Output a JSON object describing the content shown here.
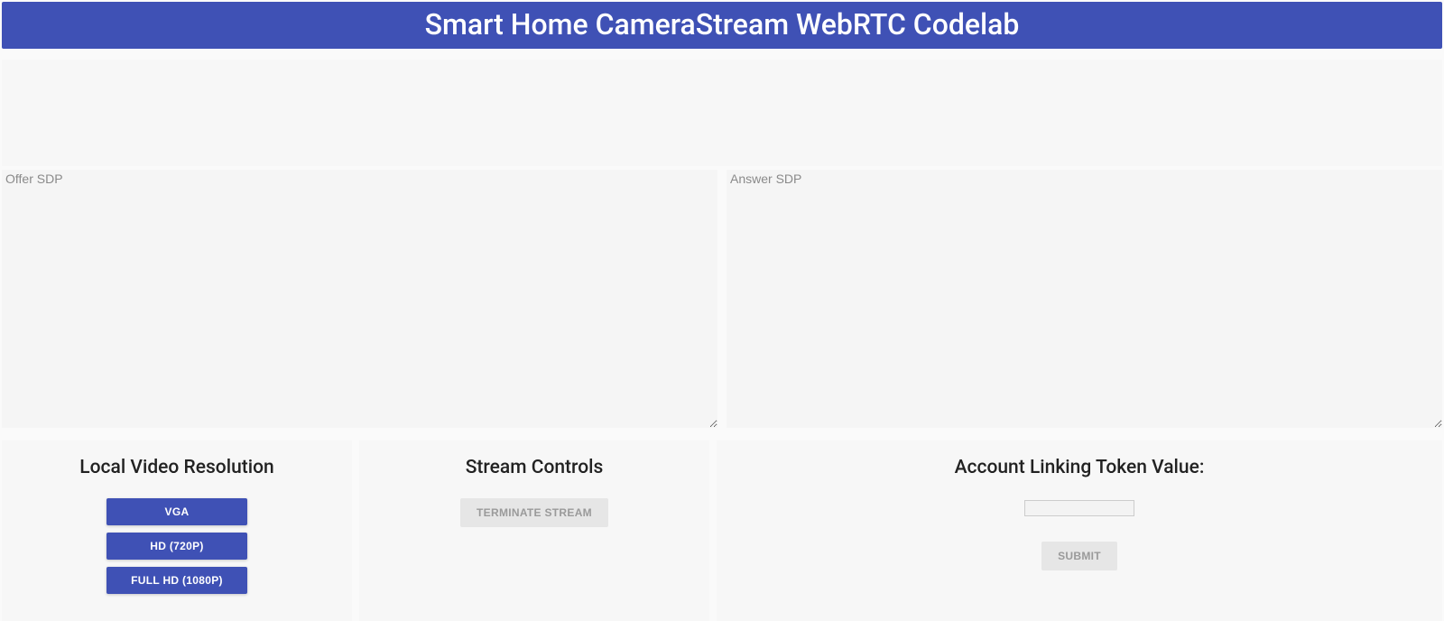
{
  "header": {
    "title": "Smart Home CameraStream WebRTC Codelab"
  },
  "sdp": {
    "offer_placeholder": "Offer SDP",
    "answer_placeholder": "Answer SDP",
    "offer_value": "",
    "answer_value": ""
  },
  "panels": {
    "resolution": {
      "title": "Local Video Resolution",
      "buttons": {
        "vga": "VGA",
        "hd": "HD (720P)",
        "fullhd": "FULL HD (1080P)"
      }
    },
    "stream": {
      "title": "Stream Controls",
      "terminate_label": "TERMINATE STREAM"
    },
    "token": {
      "title": "Account Linking Token Value:",
      "input_value": "",
      "submit_label": "SUBMIT"
    }
  }
}
